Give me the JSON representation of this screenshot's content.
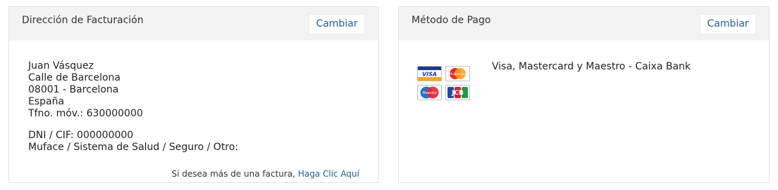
{
  "billing": {
    "title": "Dirección de Facturación",
    "change_label": "Cambiar",
    "address_lines": [
      "Juan Vásquez",
      "Calle de Barcelona",
      "08001 - Barcelona",
      "España",
      "Tfno. móv.: 630000000"
    ],
    "dni_line": "DNI / CIF: 000000000",
    "insurance_line": "Muface / Sistema de Salud / Seguro / Otro:",
    "note_text": "Si desea más de una factura,",
    "note_link": "Haga Clic Aquí"
  },
  "payment": {
    "title": "Método de Pago",
    "change_label": "Cambiar",
    "method_text": "Visa, Mastercard y Maestro - Caixa Bank",
    "card_logos": {
      "visa": "VISA",
      "mastercard": "MasterCard",
      "maestro": "Maestro",
      "jcb": "JCB"
    }
  },
  "colors": {
    "accent": "#1d5fa0",
    "header_bg": "#f3f3f3",
    "border": "#e3e3e3"
  }
}
